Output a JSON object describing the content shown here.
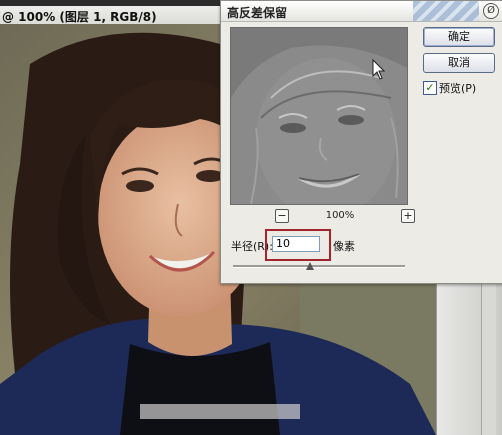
{
  "document": {
    "title": "@ 100% (图层 1, RGB/8)"
  },
  "dialog": {
    "title": "高反差保留",
    "zoom": "100%",
    "zoom_minus": "−",
    "zoom_plus": "+",
    "ok_label": "确定",
    "cancel_label": "取消",
    "preview_label": "预览(P)",
    "preview_checked": true,
    "radius_label": "半径(R):",
    "radius_value": "10",
    "radius_unit": "像素",
    "radius_slider_level": 0.45
  },
  "colors": {
    "dialog_bg": "#ecebe6",
    "highlight_box": "#a3252c",
    "check_mark": "#1b7a1b"
  },
  "icons": {
    "close": "close-icon",
    "check": "check-icon",
    "cursor": "arrow-cursor-icon"
  }
}
